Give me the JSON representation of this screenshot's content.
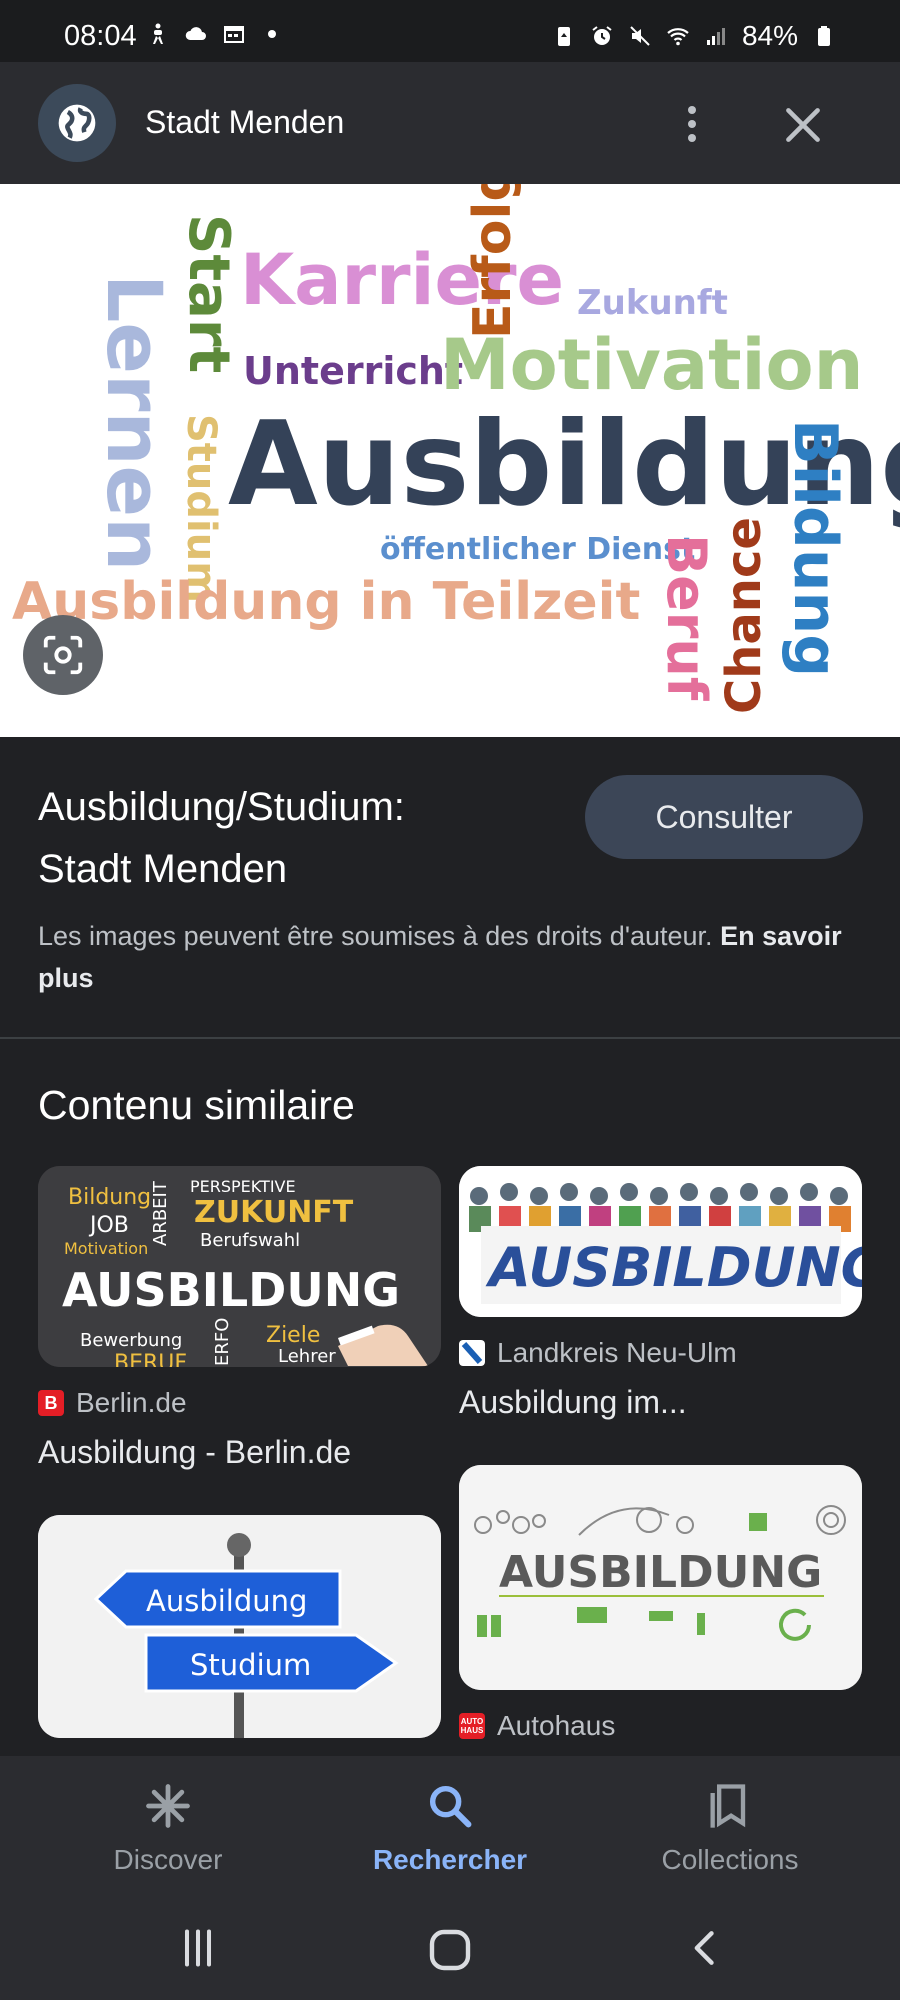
{
  "status_bar": {
    "time": "08:04",
    "battery": "84%",
    "icons_left": [
      "accessibility-icon",
      "cloud-icon",
      "calendar-icon",
      "dot-icon"
    ],
    "icons_right": [
      "battery-saver-icon",
      "alarm-icon",
      "mute-icon",
      "wifi-icon",
      "signal-icon",
      "battery-icon"
    ]
  },
  "top_bar": {
    "site_title": "Stadt Menden",
    "avatar_icon": "globe-icon",
    "more_icon": "more-vert-icon",
    "close_icon": "close-icon"
  },
  "hero_image": {
    "words": {
      "start": "Start",
      "karriere": "Karriere",
      "erfolg": "Erfolg",
      "zukunft": "Zukunft",
      "lernen": "Lernen",
      "studium": "Studium",
      "unterricht": "Unterricht",
      "motivation": "Motivation",
      "ausbildung": "Ausbildung",
      "bildung": "Bildung",
      "oeffentlicher_dienst": "öffentlicher Dienst",
      "beruf": "Beruf",
      "chance": "Chance",
      "teilzeit": "Ausbildung in Teilzeit"
    },
    "lens_icon": "lens-icon"
  },
  "result": {
    "title_line1": "Ausbildung/Studium:",
    "title_line2": "Stadt Menden",
    "button": "Consulter",
    "copyright_text": "Les images peuvent être soumises à des droits d'auteur.",
    "learn_more": "En savoir plus"
  },
  "similar": {
    "title": "Contenu similaire",
    "cards": [
      {
        "source": "Berlin.de",
        "caption": "Ausbildung - Berlin.de",
        "favicon_letter": "B",
        "favicon_color": "#e41e26",
        "chalk_words": {
          "bildung": "Bildung",
          "job": "JOB",
          "arbeit": "ARBEIT",
          "perspektive": "PERSPEKTIVE",
          "zukunft": "ZUKUNFT",
          "motivation": "Motivation",
          "berufswahl": "Berufswahl",
          "main": "AUSBILDUNG",
          "bewerbung": "Bewerbung",
          "erfolg": "ERFO",
          "ziele": "Ziele",
          "beruf": "BERUF",
          "lehrer": "Lehrer"
        }
      },
      {
        "source": "Landkreis Neu-Ulm",
        "caption": "Ausbildung im...",
        "banner_text": "AUSBILDUNG"
      },
      {
        "sign_top": "Ausbildung",
        "sign_bottom": "Studium"
      },
      {
        "source": "Autohaus",
        "banner_text": "AUSBILDUNG",
        "favicon_letter": "AUTO HAUS",
        "favicon_color": "#e41e26"
      }
    ]
  },
  "bottom_nav": {
    "discover": "Discover",
    "search": "Rechercher",
    "collections": "Collections",
    "active_color": "#8ab4f8"
  }
}
